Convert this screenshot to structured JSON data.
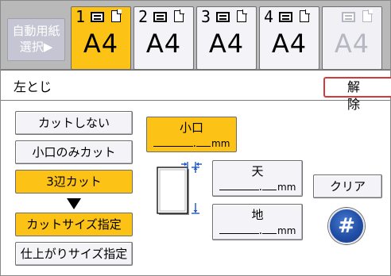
{
  "tray_bar": {
    "auto_paper_line1": "自動用紙",
    "auto_paper_line2": "選択▶",
    "trays": [
      {
        "number": "1",
        "size": "A4",
        "state": "selected"
      },
      {
        "number": "2",
        "size": "A4",
        "state": "normal"
      },
      {
        "number": "3",
        "size": "A4",
        "state": "normal"
      },
      {
        "number": "4",
        "size": "A4",
        "state": "normal"
      },
      {
        "number": "",
        "size": "A4",
        "state": "disabled"
      }
    ]
  },
  "title_row": {
    "title": "左とじ",
    "cancel_label": "解 除"
  },
  "mode_buttons": {
    "no_cut": "カットしない",
    "fore_edge_cut": "小口のみカット",
    "three_side_cut": "3辺カット",
    "cut_size": "カットサイズ指定",
    "finish_size": "仕上がりサイズ指定"
  },
  "fields": {
    "fore_edge": {
      "label": "小口",
      "unit": "mm"
    },
    "top": {
      "label": "天",
      "unit": "mm"
    },
    "bottom": {
      "label": "地",
      "unit": "mm"
    }
  },
  "actions": {
    "clear_label": "クリア",
    "hash_label": "#"
  },
  "colors": {
    "selected": "#fcc216",
    "button": "#f3f3f8",
    "tray_bar": "#b9b9b9",
    "cancel_border": "#d43a3a",
    "hash_blue": "#214fa6"
  }
}
